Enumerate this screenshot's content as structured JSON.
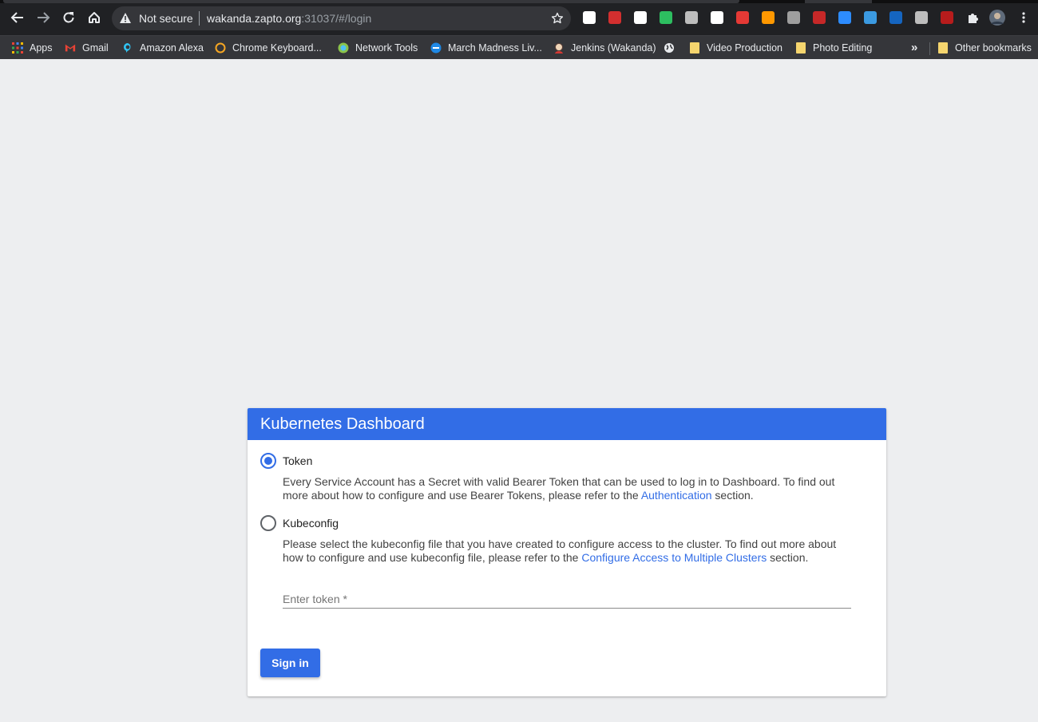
{
  "browser": {
    "omnibox": {
      "security_label": "Not secure",
      "url_host": "wakanda.zapto.org",
      "url_rest": ":31037/#/login"
    },
    "extension_colors": [
      "#ffffff",
      "#d32f2f",
      "#ffffff",
      "#2dbe60",
      "#bdbdbd",
      "#ffffff",
      "#e53935",
      "#ff9800",
      "#9e9e9e",
      "#c62828",
      "#2d8cff",
      "#3b9ae1",
      "#1565c0",
      "#bdbdbd",
      "#b71c1c"
    ],
    "bookmarks": [
      {
        "label": "Apps",
        "icon": "apps-grid-icon"
      },
      {
        "label": "Gmail",
        "icon": "gmail-icon"
      },
      {
        "label": "Amazon Alexa",
        "icon": "alexa-icon"
      },
      {
        "label": "Chrome Keyboard...",
        "icon": "chrome-keyboard-icon"
      },
      {
        "label": "Network Tools",
        "icon": "globe-icon"
      },
      {
        "label": "March Madness Liv...",
        "icon": "ncaa-icon"
      },
      {
        "label": "Jenkins (Wakanda)",
        "icon": "jenkins-icon"
      },
      {
        "label": "",
        "icon": "globe-icon"
      },
      {
        "label": "Video Production",
        "icon": "folder-icon"
      },
      {
        "label": "Photo Editing",
        "icon": "folder-icon"
      },
      {
        "label": "Other bookmarks",
        "icon": "folder-icon"
      }
    ],
    "overflow_label": "»"
  },
  "login": {
    "title": "Kubernetes Dashboard",
    "token_option": {
      "label": "Token",
      "selected": true,
      "desc_before": "Every Service Account has a Secret with valid Bearer Token that can be used to log in to Dashboard. To find out more about how to configure and use Bearer Tokens, please refer to the ",
      "link": "Authentication",
      "desc_after": " section."
    },
    "kubeconfig_option": {
      "label": "Kubeconfig",
      "selected": false,
      "desc_before": "Please select the kubeconfig file that you have created to configure access to the cluster. To find out more about how to configure and use kubeconfig file, please refer to the ",
      "link": "Configure Access to Multiple Clusters",
      "desc_after": " section."
    },
    "token_placeholder": "Enter token *",
    "token_value": "",
    "signin_label": "Sign in",
    "accent_color": "#326de6"
  }
}
